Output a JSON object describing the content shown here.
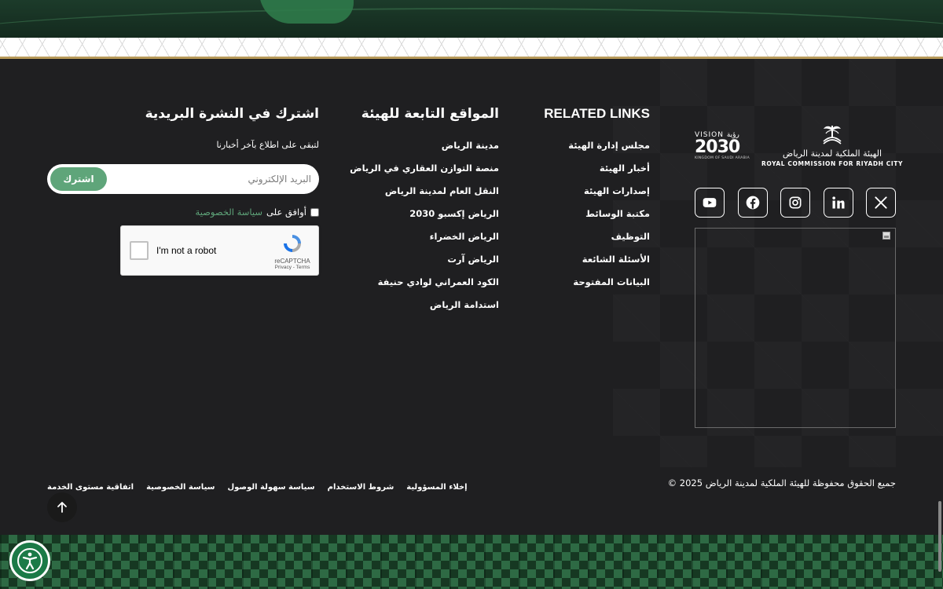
{
  "brand": {
    "rcrc_arabic": "الهيئة الملكية لمدينة الرياض",
    "rcrc_english": "ROYAL COMMISSION FOR RIYADH CITY",
    "vision_top": "VISION رؤية",
    "vision_number": "2030",
    "vision_sub": "KINGDOM OF SAUDI ARABIA"
  },
  "social": [
    {
      "name": "x-icon"
    },
    {
      "name": "linkedin-icon"
    },
    {
      "name": "instagram-icon"
    },
    {
      "name": "facebook-icon"
    },
    {
      "name": "youtube-icon"
    }
  ],
  "related_links": {
    "title": "RELATED LINKS",
    "items": [
      "مجلس إدارة الهيئة",
      "أخبار الهيئة",
      "إصدارات الهيئة",
      "مكتبة الوسائط",
      "التوظيف",
      "الأسئلة الشائعة",
      "البيانات المفتوحة"
    ]
  },
  "affiliated_sites": {
    "title": "المواقع التابعة للهيئة",
    "items": [
      "مدينة الرياض",
      "منصة التوازن العقاري في الرياض",
      "النقل العام لمدينة الرياض",
      "الرياض إكسبو 2030",
      "الرياض الخضراء",
      "الرياض آرت",
      "الكود العمراني لوادي حنيفة",
      "استدامة الرياض"
    ]
  },
  "newsletter": {
    "title": "اشترك في النشرة البريدية",
    "subtitle": "لتبقى على اطلاع بآخر أخبارنا",
    "email_placeholder": "البريد الإلكتروني",
    "subscribe_label": "اشترك",
    "agree_label": "أوافق على",
    "privacy_link": "سياسة الخصوصية"
  },
  "captcha": {
    "label": "I'm not a robot",
    "brand": "reCAPTCHA",
    "terms": "Privacy - Terms"
  },
  "footer": {
    "copyright": "جميع الحقوق محفوظة للهيئة الملكية لمدينة الرياض 2025 ©",
    "legal_links": [
      "اتفاقية مستوى الخدمة",
      "سياسة الخصوصية",
      "سياسة سهولة الوصول",
      "شروط الاستخدام",
      "إخلاء المسؤولية"
    ]
  },
  "colors": {
    "background": "#1f1f21",
    "accent_green": "#5fa57a",
    "gold": "#b89a5a",
    "accessibility_green": "#1b7a47"
  }
}
